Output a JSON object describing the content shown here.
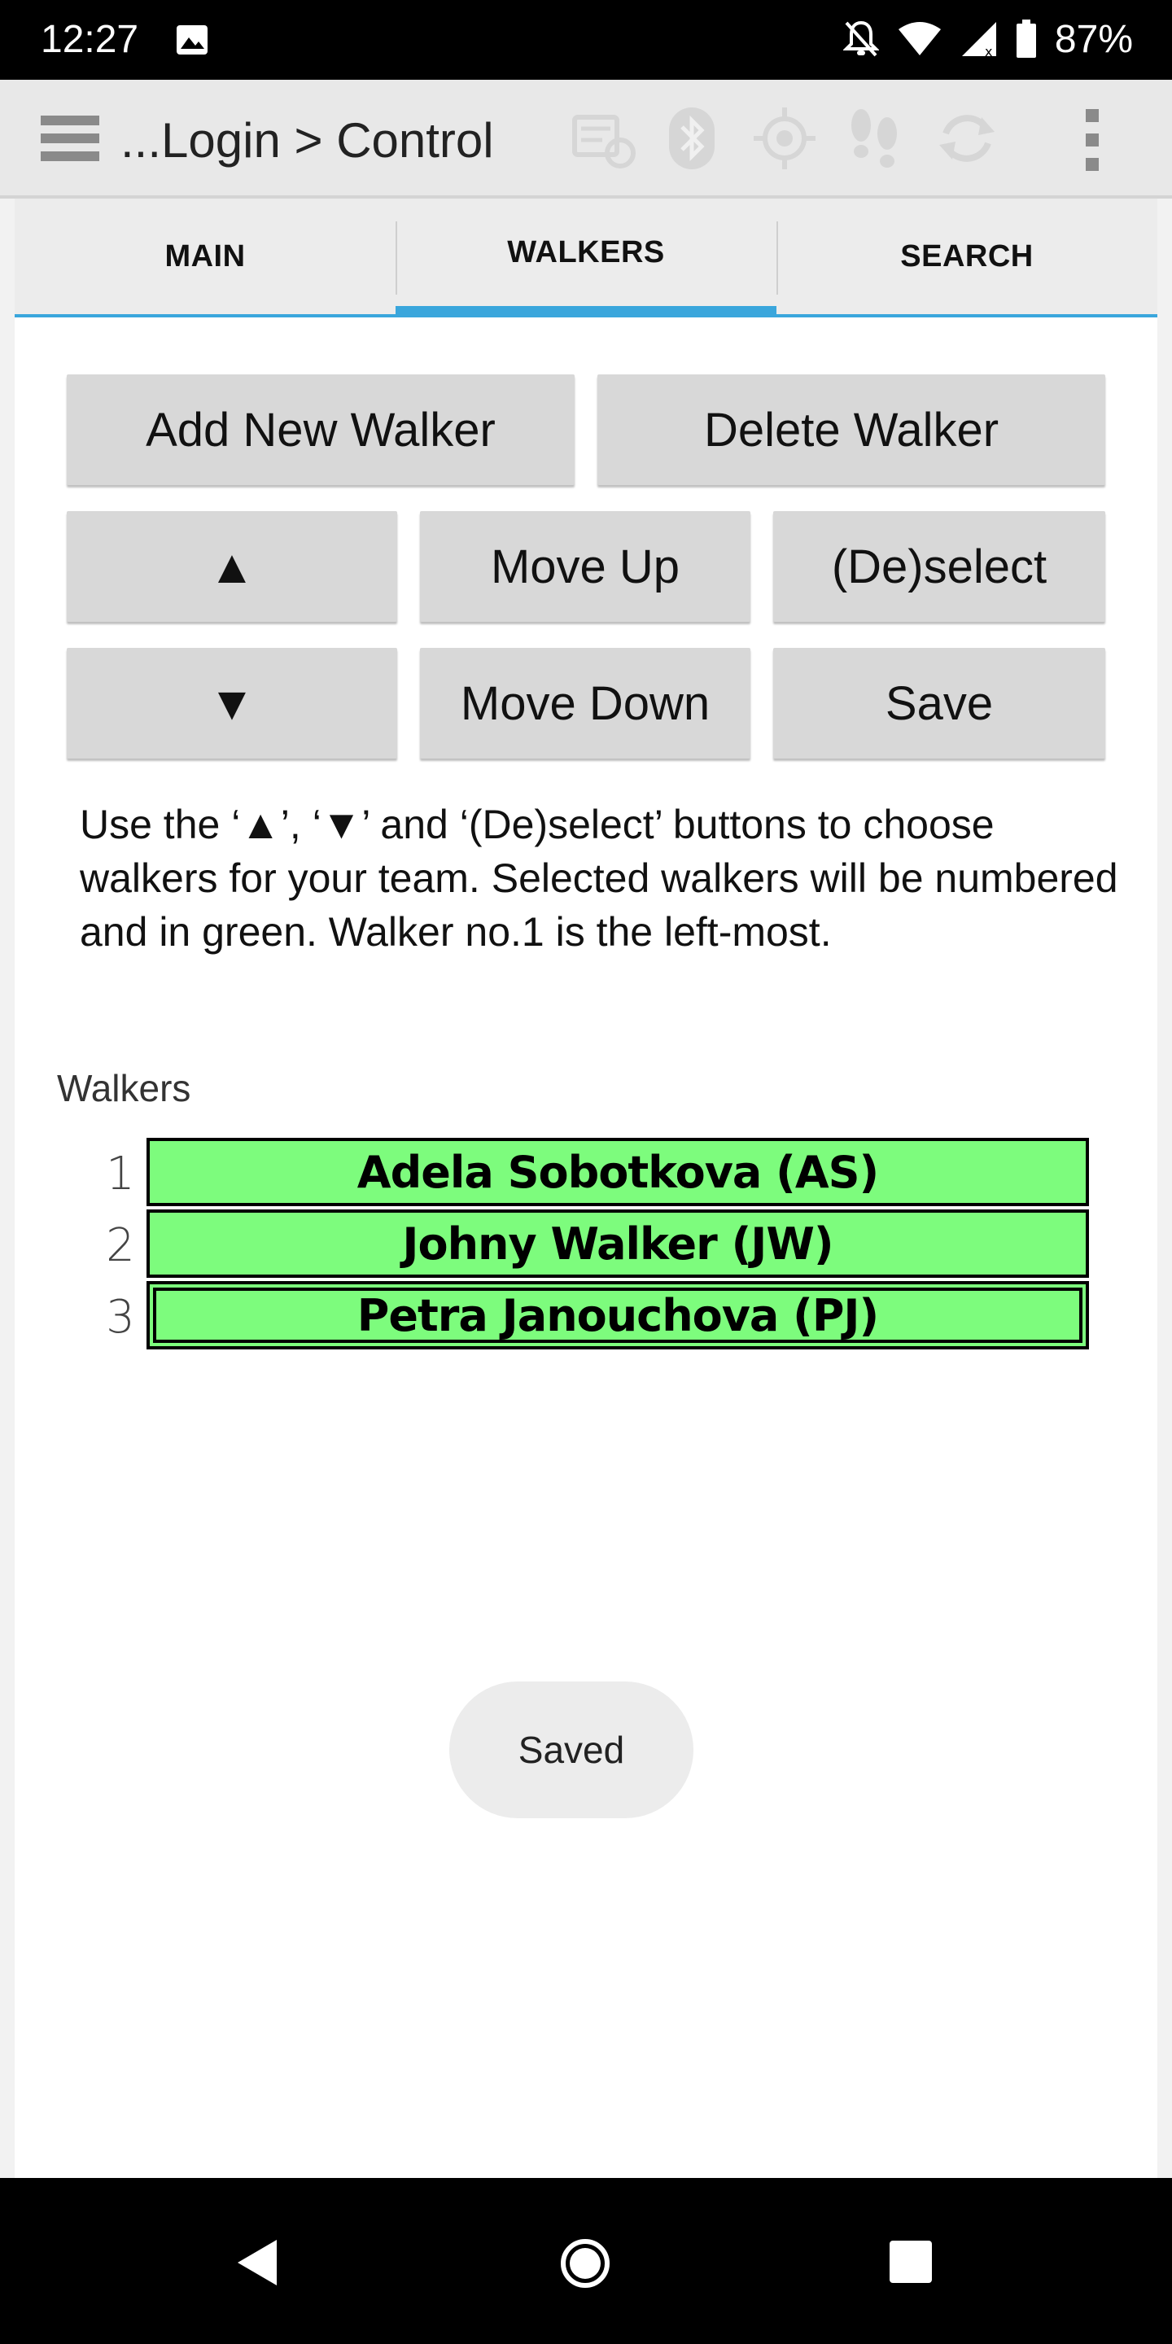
{
  "status_bar": {
    "time": "12:27",
    "battery": "87%"
  },
  "toolbar": {
    "title": "...Login > Control",
    "icons": [
      "menu-icon",
      "sync-icon",
      "bluetooth-icon",
      "gps-icon",
      "footsteps-icon",
      "refresh-icon",
      "overflow-menu-icon"
    ]
  },
  "tabs": [
    {
      "label": "MAIN",
      "active": false
    },
    {
      "label": "WALKERS",
      "active": true
    },
    {
      "label": "SEARCH",
      "active": false
    }
  ],
  "buttons": {
    "add": "Add New Walker",
    "delete": "Delete Walker",
    "up_arrow": "▲",
    "move_up": "Move Up",
    "deselect": "(De)select",
    "down_arrow": "▼",
    "move_down": "Move Down",
    "save": "Save"
  },
  "help_text": "Use the ‘▲’, ‘▼’ and ‘(De)select’ buttons to choose walkers for your team. Selected walkers will be numbered and in green. Walker no.1 is the left-most.",
  "walkers": {
    "label": "Walkers",
    "items": [
      {
        "number": "1",
        "name": "Adela Sobotkova (AS)"
      },
      {
        "number": "2",
        "name": "Johny Walker (JW)"
      },
      {
        "number": "3",
        "name": "Petra Janouchova (PJ)"
      }
    ]
  },
  "toast": "Saved",
  "colors": {
    "accent": "#3aa6dc",
    "selected_walker": "#7dfc7d",
    "button_bg": "#d8d8d8"
  }
}
